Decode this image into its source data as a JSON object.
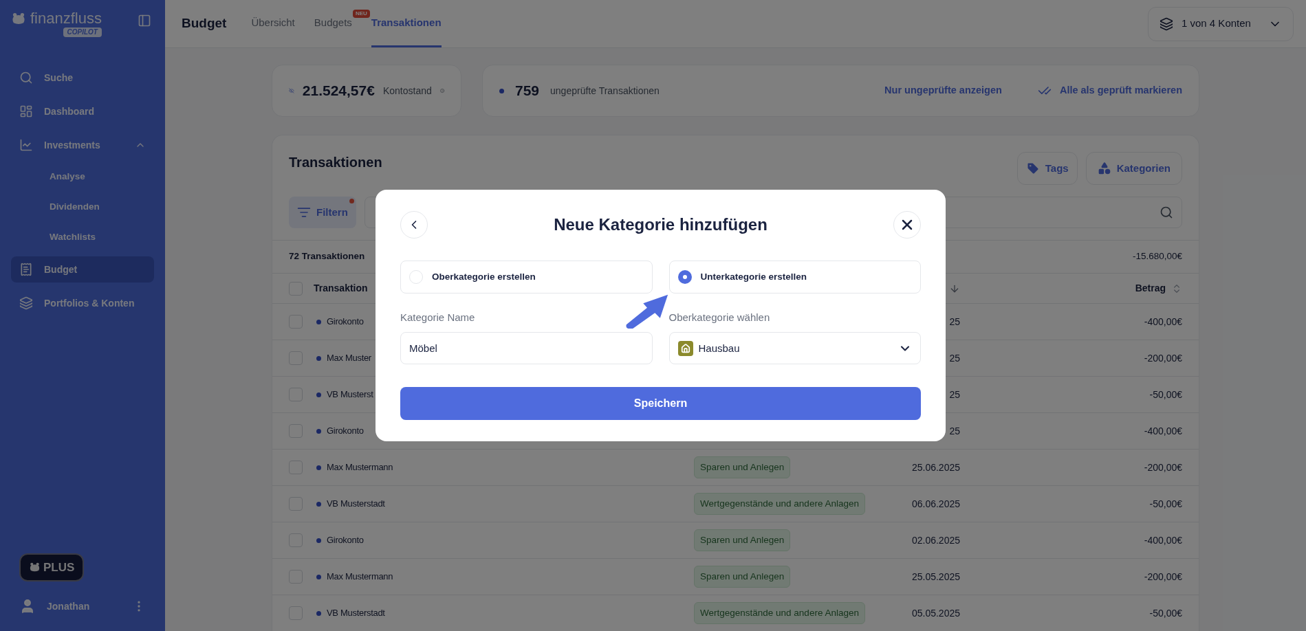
{
  "sidebar": {
    "logo": "finanzfluss",
    "logo_badge": "COPILOT",
    "items": [
      {
        "label": "Suche",
        "selected": false
      },
      {
        "label": "Dashboard",
        "selected": false
      },
      {
        "label": "Investments",
        "selected": false,
        "expanded": true,
        "children": [
          {
            "label": "Analyse",
            "selected": false
          },
          {
            "label": "Dividenden",
            "selected": false
          },
          {
            "label": "Watchlists",
            "selected": false
          }
        ]
      },
      {
        "label": "Budget",
        "selected": true
      },
      {
        "label": "Portfolios & Konten",
        "selected": false
      }
    ],
    "plan_badge": "PLUS",
    "user": "Jonathan"
  },
  "top_bar": {
    "title": "Budget",
    "tabs": [
      {
        "label": "Übersicht",
        "selected": false
      },
      {
        "label": "Budgets",
        "selected": false,
        "badge": "NEU"
      },
      {
        "label": "Transaktionen",
        "selected": true
      }
    ],
    "account_selector": "1 von 4 Konten"
  },
  "balance": {
    "value": "21.524,57€",
    "label": "Kontostand"
  },
  "unchecked": {
    "count": "759",
    "label": "ungeprüfte Transaktionen",
    "actions": [
      "Nur ungeprüfte anzeigen",
      "Alle als geprüft markieren"
    ]
  },
  "transactions": {
    "title": "Transaktionen",
    "buttons": [
      "Tags",
      "Kategorien"
    ],
    "filter": {
      "label": "Filtern",
      "active": true
    },
    "summary": {
      "count": "72 Transaktionen",
      "total": "-15.680,00€"
    },
    "select_all": {
      "checked": false
    },
    "columns": [
      "Transaktion",
      "Betrag"
    ],
    "rows": [
      {
        "checked": false,
        "name": "Girokonto",
        "date": "25",
        "amount": "-400,00€"
      },
      {
        "checked": false,
        "name": "Max Muster",
        "date": "25",
        "amount": "-200,00€"
      },
      {
        "checked": false,
        "name": "VB Musterst",
        "date": "25",
        "amount": "-50,00€"
      },
      {
        "checked": false,
        "name": "Girokonto",
        "date": "25",
        "amount": "-400,00€"
      },
      {
        "checked": false,
        "name": "Max Mustermann",
        "category": "Sparen und Anlegen",
        "date": "25.06.2025",
        "amount": "-200,00€"
      },
      {
        "checked": false,
        "name": "VB Musterstadt",
        "category": "Wertgegenstände und andere Anlagen",
        "date": "06.06.2025",
        "amount": "-50,00€"
      },
      {
        "checked": false,
        "name": "Girokonto",
        "category": "Sparen und Anlegen",
        "date": "02.06.2025",
        "amount": "-400,00€"
      },
      {
        "checked": false,
        "name": "Max Mustermann",
        "category": "Sparen und Anlegen",
        "date": "25.05.2025",
        "amount": "-200,00€"
      },
      {
        "checked": false,
        "name": "VB Musterstadt",
        "category": "Wertgegenstände und andere Anlagen",
        "date": "05.05.2025",
        "amount": "-50,00€"
      }
    ]
  },
  "dialog": {
    "title": "Neue Kategorie hinzufügen",
    "options": [
      {
        "label": "Oberkategorie erstellen",
        "selected": false
      },
      {
        "label": "Unterkategorie erstellen",
        "selected": true
      }
    ],
    "name_field": {
      "label": "Kategorie Name",
      "value": "Möbel"
    },
    "parent_select": {
      "label": "Oberkategorie wählen",
      "value": "Hausbau"
    },
    "save_button": "Speichern"
  }
}
